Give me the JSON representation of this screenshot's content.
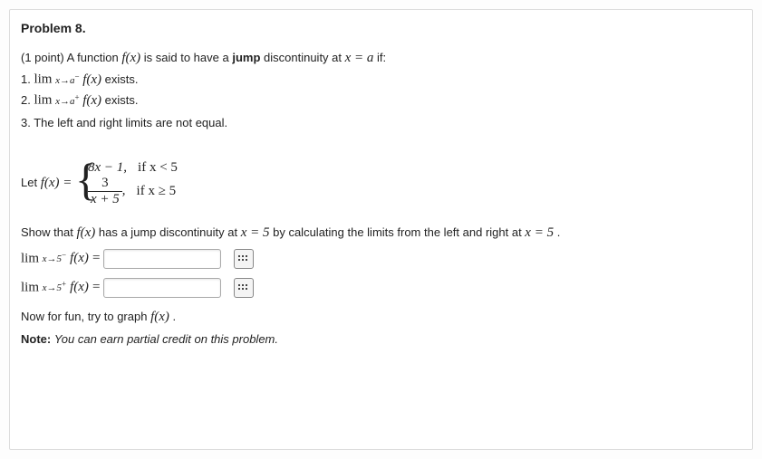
{
  "problem": {
    "title": "Problem 8.",
    "points_prefix": "(1 point) ",
    "intro_1": "A function ",
    "fx": "f(x)",
    "intro_2": " is said to have a ",
    "jump_word": "jump",
    "intro_3": " discontinuity at ",
    "xeq_a": "x = a",
    "intro_4": " if:",
    "cond1": {
      "num": "1.",
      "lim_top": "lim",
      "lim_bot_l": "x→a",
      "lim_bot_sup": "−",
      "fx": "f(x)",
      "tail": " exists."
    },
    "cond2": {
      "num": "2.",
      "lim_top": "lim",
      "lim_bot_l": "x→a",
      "lim_bot_sup": "+",
      "fx": "f(x)",
      "tail": " exists."
    },
    "cond3": {
      "num": "3.",
      "text": "The left and right limits are not equal."
    },
    "let_label": "Let ",
    "piecewise": {
      "row1_expr": "8x − 1,",
      "row1_cond": "if x < 5",
      "row2_num": "3",
      "row2_den": "x + 5",
      "row2_comma": ",",
      "row2_cond": "if x ≥ 5"
    },
    "show_text_1": "Show that ",
    "show_text_2": " has a jump discontinuity at ",
    "x_eq_5": "x = 5",
    "show_text_3": " by calculating the limits from the left and right at ",
    "show_text_4": ".",
    "ans1": {
      "lim_top": "lim",
      "lim_bot_l": "x→5",
      "lim_bot_sup": "−",
      "fx": "f(x)",
      "eq": "="
    },
    "ans2": {
      "lim_top": "lim",
      "lim_bot_l": "x→5",
      "lim_bot_sup": "+",
      "fx": "f(x)",
      "eq": "="
    },
    "fun_text_1": "Now for fun, try to graph ",
    "fun_text_2": ".",
    "note_label": "Note:",
    "note_text": " You can earn partial credit on this problem."
  }
}
